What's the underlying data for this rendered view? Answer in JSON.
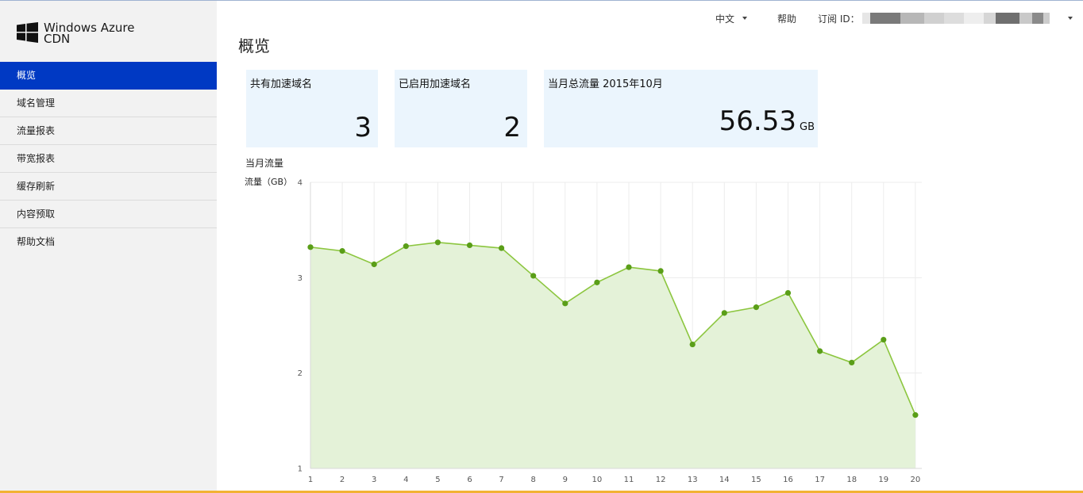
{
  "app": {
    "logo_line1": "Windows Azure",
    "logo_line2": "CDN"
  },
  "sidebar": {
    "items": [
      {
        "label": "概览",
        "active": true
      },
      {
        "label": "域名管理",
        "active": false
      },
      {
        "label": "流量报表",
        "active": false
      },
      {
        "label": "带宽报表",
        "active": false
      },
      {
        "label": "缓存刷新",
        "active": false
      },
      {
        "label": "内容预取",
        "active": false
      },
      {
        "label": "帮助文档",
        "active": false
      }
    ]
  },
  "header": {
    "language": "中文",
    "help": "帮助",
    "subscription_label": "订阅 ID："
  },
  "page": {
    "title": "概览"
  },
  "cards": [
    {
      "label": "共有加速域名",
      "value": "3",
      "unit": ""
    },
    {
      "label": "已启用加速域名",
      "value": "2",
      "unit": ""
    },
    {
      "label": "当月总流量 2015年10月",
      "value": "56.53",
      "unit": "GB"
    }
  ],
  "chart_data": {
    "type": "area",
    "title": "当月流量",
    "ylabel": "流量（GB）",
    "xlabel": "",
    "x": [
      1,
      2,
      3,
      4,
      5,
      6,
      7,
      8,
      9,
      10,
      11,
      12,
      13,
      14,
      15,
      16,
      17,
      18,
      19,
      20
    ],
    "series": [
      {
        "values": [
          3.32,
          3.28,
          3.14,
          3.33,
          3.37,
          3.34,
          3.31,
          3.02,
          2.73,
          2.95,
          3.11,
          3.07,
          2.3,
          2.63,
          2.69,
          2.84,
          2.23,
          2.11,
          2.35,
          1.56
        ]
      }
    ],
    "yticks": [
      1,
      2,
      3,
      4
    ],
    "ylim": [
      1,
      4
    ],
    "grid": true,
    "legend": "none",
    "line_color": "#8cc63f",
    "point_color": "#5a9e18",
    "fill_color": "#e4f2d8"
  },
  "colors": {
    "accent": "#0039c3",
    "card_bg": "#ebf5fd",
    "sidebar_bg": "#f2f2f2"
  }
}
